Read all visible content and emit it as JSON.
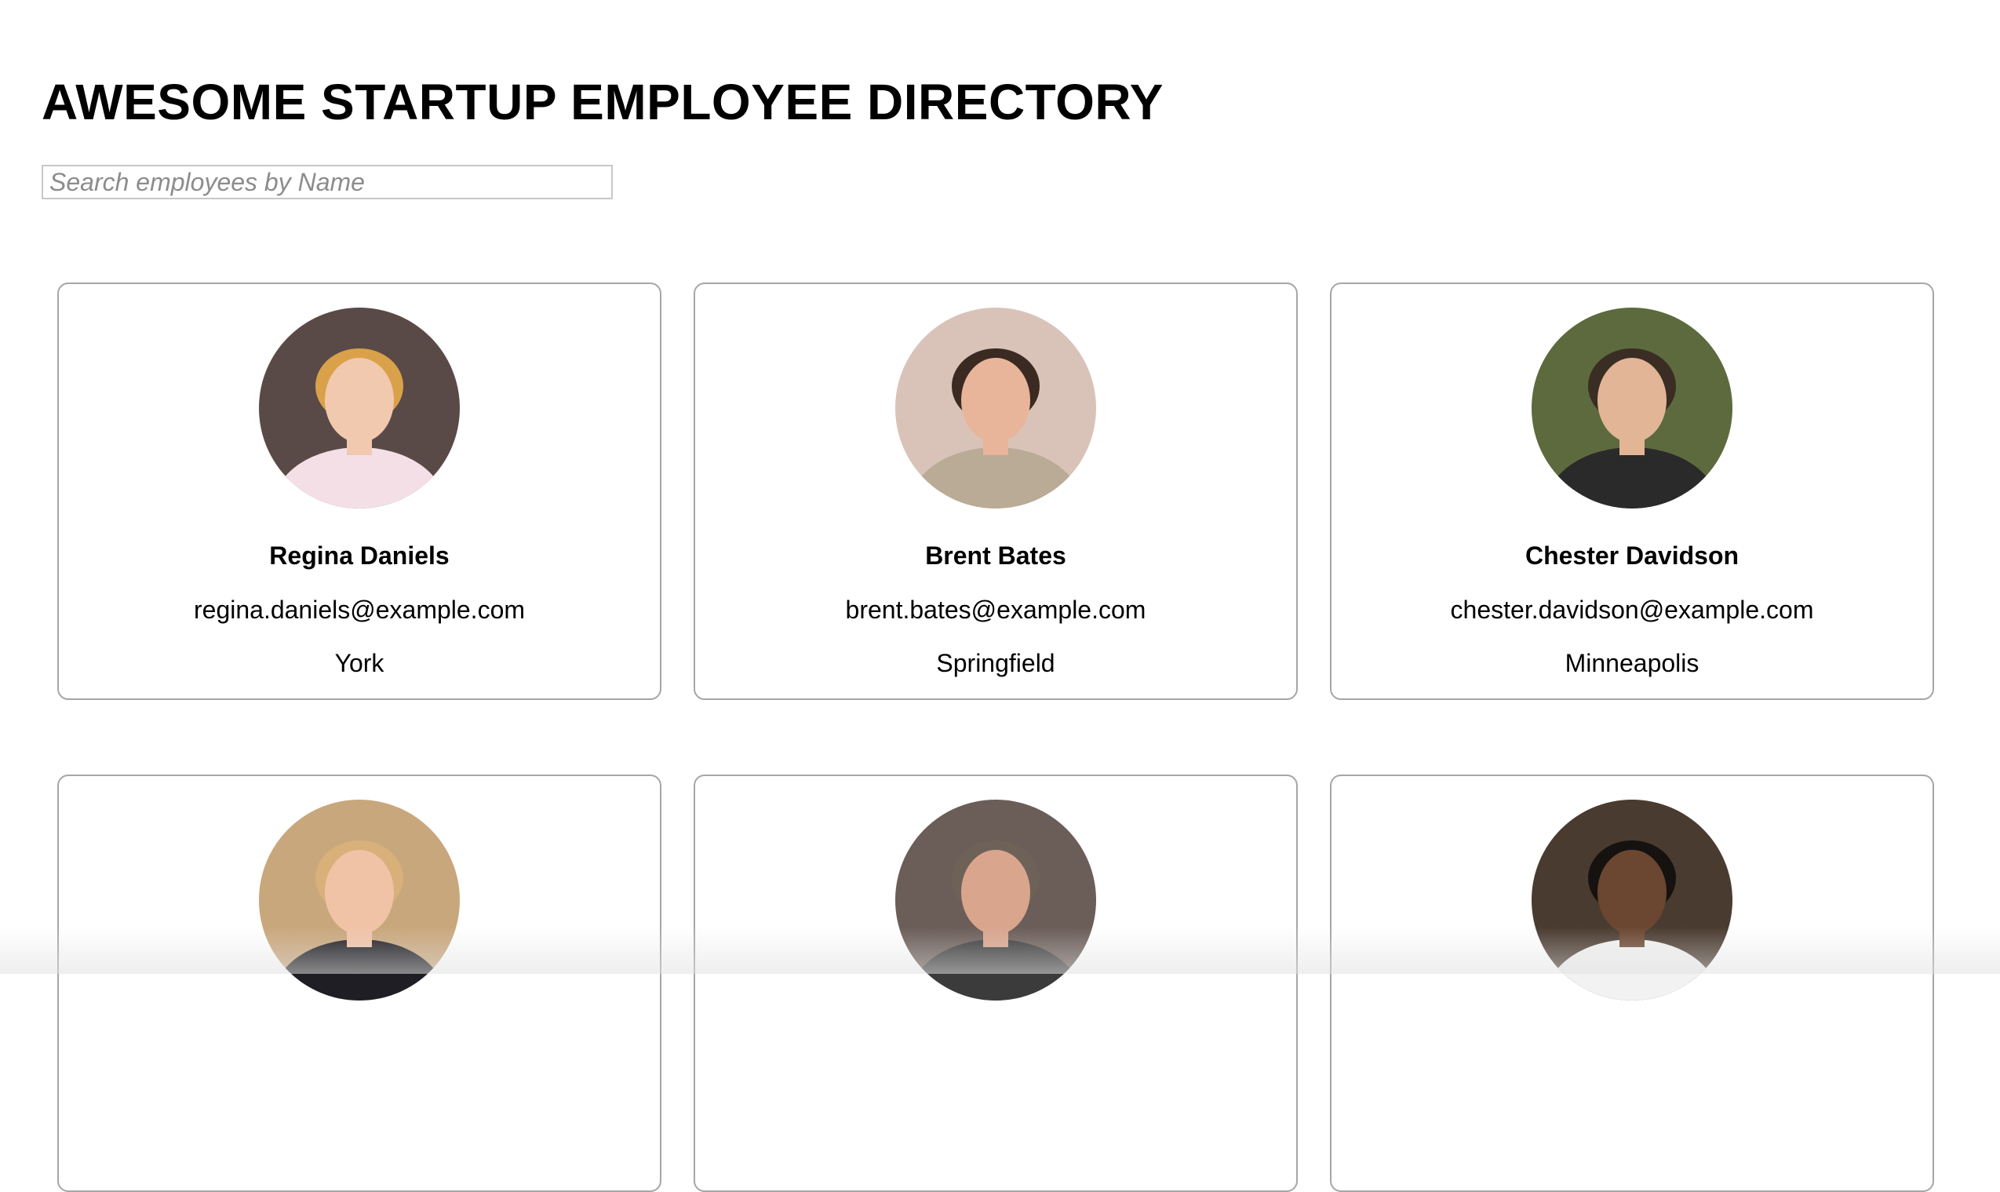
{
  "header": {
    "title": "AWESOME STARTUP EMPLOYEE DIRECTORY"
  },
  "search": {
    "placeholder": "Search employees by Name",
    "value": ""
  },
  "employees": [
    {
      "name": "Regina Daniels",
      "email": "regina.daniels@example.com",
      "city": "York",
      "photo": {
        "bg": "#5a4a47",
        "skin": "#f1c9ae",
        "hair": "#d9a14a",
        "shirt": "#f5dfe6"
      }
    },
    {
      "name": "Brent Bates",
      "email": "brent.bates@example.com",
      "city": "Springfield",
      "photo": {
        "bg": "#d9c3b8",
        "skin": "#e8b59a",
        "hair": "#3b2a22",
        "shirt": "#b9ab96"
      }
    },
    {
      "name": "Chester Davidson",
      "email": "chester.davidson@example.com",
      "city": "Minneapolis",
      "photo": {
        "bg": "#5c6a3e",
        "skin": "#e2b596",
        "hair": "#3a2d24",
        "shirt": "#2a2a2a"
      }
    },
    {
      "name": "",
      "email": "",
      "city": "",
      "photo": {
        "bg": "#c9a77c",
        "skin": "#f0c3a7",
        "hair": "#d7b07a",
        "shirt": "#1e1e24"
      }
    },
    {
      "name": "",
      "email": "",
      "city": "",
      "photo": {
        "bg": "#6b5d58",
        "skin": "#d9a58d",
        "hair": "#6e6258",
        "shirt": "#3b3b3b"
      }
    },
    {
      "name": "",
      "email": "",
      "city": "",
      "photo": {
        "bg": "#4a3b30",
        "skin": "#6b4631",
        "hair": "#161210",
        "shirt": "#f2f2f2"
      }
    }
  ]
}
